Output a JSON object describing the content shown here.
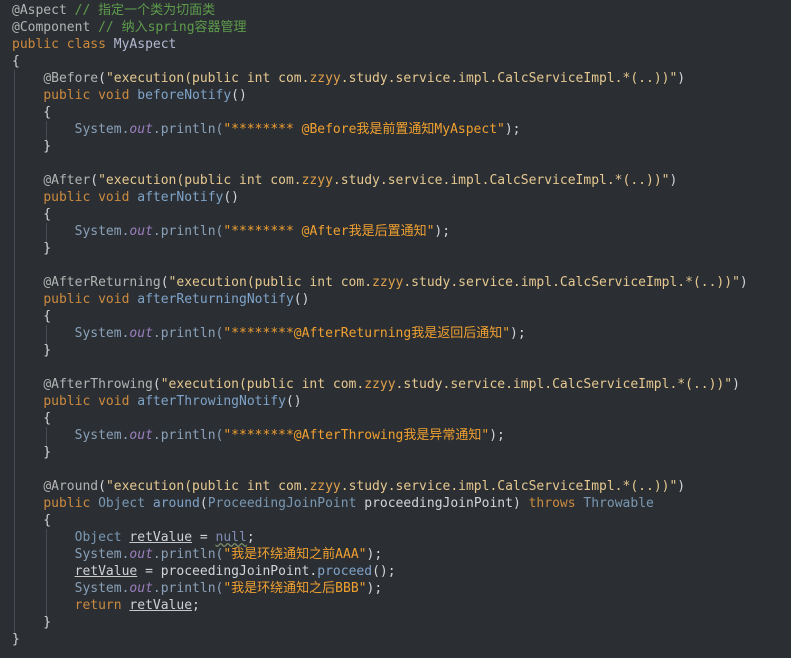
{
  "code": {
    "lines": [
      [
        [
          "ann",
          "@Aspect"
        ],
        [
          "plain",
          " "
        ],
        [
          "cmt",
          "// 指定一个类为切面类"
        ]
      ],
      [
        [
          "ann",
          "@Component"
        ],
        [
          "plain",
          " "
        ],
        [
          "cmt",
          "// 纳入spring容器管理"
        ]
      ],
      [
        [
          "kw",
          "public"
        ],
        [
          "plain",
          " "
        ],
        [
          "kw",
          "class"
        ],
        [
          "plain",
          " "
        ],
        [
          "cls",
          "MyAspect"
        ]
      ],
      [
        [
          "brace",
          "{"
        ]
      ],
      [
        [
          "plain",
          "    "
        ],
        [
          "ann",
          "@Before"
        ],
        [
          "plain",
          "("
        ],
        [
          "str",
          "\"execution(public int com."
        ],
        [
          "zzyy",
          "zzyy"
        ],
        [
          "str",
          ".study.service.impl.CalcServiceImpl.*(..))\""
        ],
        [
          "plain",
          ")"
        ]
      ],
      [
        [
          "plain",
          "    "
        ],
        [
          "kw",
          "public"
        ],
        [
          "plain",
          " "
        ],
        [
          "kw",
          "void"
        ],
        [
          "plain",
          " "
        ],
        [
          "fn",
          "beforeNotify"
        ],
        [
          "plain",
          "()"
        ]
      ],
      [
        [
          "plain",
          "    {"
        ]
      ],
      [
        [
          "plain",
          "        "
        ],
        [
          "sys",
          "System."
        ],
        [
          "field",
          "out"
        ],
        [
          "sys",
          ".println("
        ],
        [
          "strbr",
          "\"******** @Before我是前置通知MyAspect\""
        ],
        [
          "plain",
          ");"
        ]
      ],
      [
        [
          "plain",
          "    }"
        ]
      ],
      [
        [
          "plain",
          ""
        ]
      ],
      [
        [
          "plain",
          "    "
        ],
        [
          "ann",
          "@After"
        ],
        [
          "plain",
          "("
        ],
        [
          "str",
          "\"execution(public int com."
        ],
        [
          "zzyy",
          "zzyy"
        ],
        [
          "str",
          ".study.service.impl.CalcServiceImpl.*(..))\""
        ],
        [
          "plain",
          ")"
        ]
      ],
      [
        [
          "plain",
          "    "
        ],
        [
          "kw",
          "public"
        ],
        [
          "plain",
          " "
        ],
        [
          "kw",
          "void"
        ],
        [
          "plain",
          " "
        ],
        [
          "fn",
          "afterNotify"
        ],
        [
          "plain",
          "()"
        ]
      ],
      [
        [
          "plain",
          "    {"
        ]
      ],
      [
        [
          "plain",
          "        "
        ],
        [
          "sys",
          "System."
        ],
        [
          "field",
          "out"
        ],
        [
          "sys",
          ".println("
        ],
        [
          "strbr",
          "\"******** @After我是后置通知\""
        ],
        [
          "plain",
          ");"
        ]
      ],
      [
        [
          "plain",
          "    }"
        ]
      ],
      [
        [
          "plain",
          ""
        ]
      ],
      [
        [
          "plain",
          "    "
        ],
        [
          "ann",
          "@AfterReturning"
        ],
        [
          "plain",
          "("
        ],
        [
          "str",
          "\"execution(public int com."
        ],
        [
          "zzyy",
          "zzyy"
        ],
        [
          "str",
          ".study.service.impl.CalcServiceImpl.*(..))\""
        ],
        [
          "plain",
          ")"
        ]
      ],
      [
        [
          "plain",
          "    "
        ],
        [
          "kw",
          "public"
        ],
        [
          "plain",
          " "
        ],
        [
          "kw",
          "void"
        ],
        [
          "plain",
          " "
        ],
        [
          "fn",
          "afterReturningNotify"
        ],
        [
          "plain",
          "()"
        ]
      ],
      [
        [
          "plain",
          "    {"
        ]
      ],
      [
        [
          "plain",
          "        "
        ],
        [
          "sys",
          "System."
        ],
        [
          "field",
          "out"
        ],
        [
          "sys",
          ".println("
        ],
        [
          "strbr",
          "\"********@AfterReturning我是返回后通知\""
        ],
        [
          "plain",
          ");"
        ]
      ],
      [
        [
          "plain",
          "    }"
        ]
      ],
      [
        [
          "plain",
          ""
        ]
      ],
      [
        [
          "plain",
          "    "
        ],
        [
          "ann",
          "@AfterThrowing"
        ],
        [
          "plain",
          "("
        ],
        [
          "str",
          "\"execution(public int com."
        ],
        [
          "zzyy",
          "zzyy"
        ],
        [
          "str",
          ".study.service.impl.CalcServiceImpl.*(..))\""
        ],
        [
          "plain",
          ")"
        ]
      ],
      [
        [
          "plain",
          "    "
        ],
        [
          "kw",
          "public"
        ],
        [
          "plain",
          " "
        ],
        [
          "kw",
          "void"
        ],
        [
          "plain",
          " "
        ],
        [
          "fn",
          "afterThrowingNotify"
        ],
        [
          "plain",
          "()"
        ]
      ],
      [
        [
          "plain",
          "    {"
        ]
      ],
      [
        [
          "plain",
          "        "
        ],
        [
          "sys",
          "System."
        ],
        [
          "field",
          "out"
        ],
        [
          "sys",
          ".println("
        ],
        [
          "strbr",
          "\"********@AfterThrowing我是异常通知\""
        ],
        [
          "plain",
          ");"
        ]
      ],
      [
        [
          "plain",
          "    }"
        ]
      ],
      [
        [
          "plain",
          ""
        ]
      ],
      [
        [
          "plain",
          "    "
        ],
        [
          "ann",
          "@Around"
        ],
        [
          "plain",
          "("
        ],
        [
          "str",
          "\"execution(public int com."
        ],
        [
          "zzyy",
          "zzyy"
        ],
        [
          "str",
          ".study.service.impl.CalcServiceImpl.*(..))\""
        ],
        [
          "plain",
          ")"
        ]
      ],
      [
        [
          "plain",
          "    "
        ],
        [
          "kw",
          "public"
        ],
        [
          "plain",
          " "
        ],
        [
          "typ",
          "Object"
        ],
        [
          "plain",
          " "
        ],
        [
          "fn",
          "around"
        ],
        [
          "plain",
          "("
        ],
        [
          "typ",
          "ProceedingJoinPoint"
        ],
        [
          "plain",
          " proceedingJoinPoint) "
        ],
        [
          "kw",
          "throws"
        ],
        [
          "plain",
          " "
        ],
        [
          "typ",
          "Throwable"
        ]
      ],
      [
        [
          "plain",
          "    {"
        ]
      ],
      [
        [
          "plain",
          "        "
        ],
        [
          "typ",
          "Object"
        ],
        [
          "plain",
          " "
        ],
        [
          "ul",
          "retValue"
        ],
        [
          "plain",
          " = "
        ],
        [
          "null wavy",
          "null"
        ],
        [
          "plain",
          ";"
        ]
      ],
      [
        [
          "plain",
          "        "
        ],
        [
          "sys",
          "System."
        ],
        [
          "field",
          "out"
        ],
        [
          "sys",
          ".println("
        ],
        [
          "strbr",
          "\"我是环绕通知之前AAA\""
        ],
        [
          "plain",
          ");"
        ]
      ],
      [
        [
          "plain",
          "        "
        ],
        [
          "ul",
          "retValue"
        ],
        [
          "plain",
          " = proceedingJoinPoint."
        ],
        [
          "fn",
          "proceed"
        ],
        [
          "plain",
          "();"
        ]
      ],
      [
        [
          "plain",
          "        "
        ],
        [
          "sys",
          "System."
        ],
        [
          "field",
          "out"
        ],
        [
          "sys",
          ".println("
        ],
        [
          "strbr",
          "\"我是环绕通知之后BBB\""
        ],
        [
          "plain",
          ");"
        ]
      ],
      [
        [
          "plain",
          "        "
        ],
        [
          "kw",
          "return"
        ],
        [
          "plain",
          " "
        ],
        [
          "ul",
          "retValue"
        ],
        [
          "plain",
          ";"
        ]
      ],
      [
        [
          "plain",
          "    }"
        ]
      ],
      [
        [
          "brace",
          "}"
        ]
      ]
    ]
  },
  "colors": {
    "background": "#2b2f33",
    "keyword": "#cc8a3e",
    "annotation": "#b3b3b3",
    "comment": "#5e9c4c",
    "string": "#e6c890",
    "method": "#7fa3c9"
  }
}
